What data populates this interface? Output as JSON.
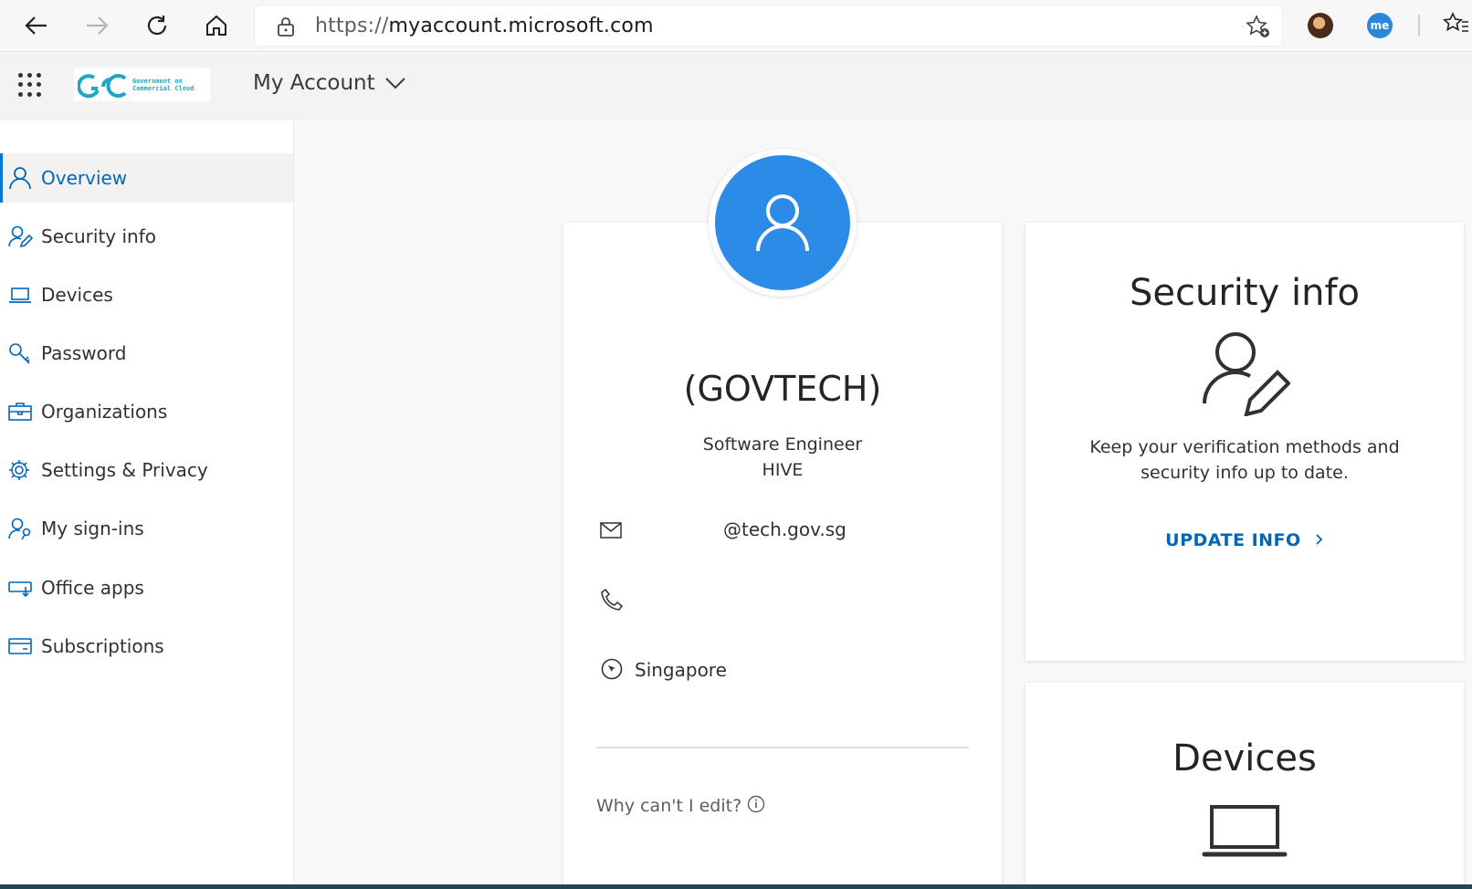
{
  "browser": {
    "url_protocol": "https://",
    "url_host": "myaccount.microsoft.com",
    "profile_badge": "me"
  },
  "header": {
    "logo_text_line1": "Government on",
    "logo_text_line2": "Commercial Cloud",
    "app_title": "My Account"
  },
  "sidebar": {
    "items": [
      {
        "label": "Overview",
        "icon": "person-icon"
      },
      {
        "label": "Security info",
        "icon": "person-pen-icon"
      },
      {
        "label": "Devices",
        "icon": "laptop-icon"
      },
      {
        "label": "Password",
        "icon": "key-icon"
      },
      {
        "label": "Organizations",
        "icon": "briefcase-icon"
      },
      {
        "label": "Settings & Privacy",
        "icon": "gear-icon"
      },
      {
        "label": "My sign-ins",
        "icon": "person-key-icon"
      },
      {
        "label": "Office apps",
        "icon": "download-icon"
      },
      {
        "label": "Subscriptions",
        "icon": "card-icon"
      }
    ]
  },
  "profile": {
    "name": "(GOVTECH)",
    "title": "Software Engineer",
    "department": "HIVE",
    "email": "@tech.gov.sg",
    "phone": "",
    "location": "Singapore",
    "why_cant_edit": "Why can't I edit?"
  },
  "security_card": {
    "title": "Security info",
    "description": "Keep your verification methods and security info up to date.",
    "link": "UPDATE INFO"
  },
  "devices_card": {
    "title": "Devices"
  },
  "colors": {
    "accent": "#0078d4",
    "link": "#0067b8",
    "avatar": "#2d8be8"
  }
}
